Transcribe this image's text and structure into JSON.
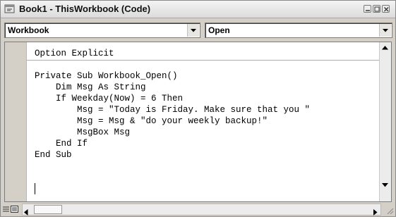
{
  "window": {
    "title": "Book1 - ThisWorkbook (Code)"
  },
  "object_dropdown": {
    "value": "Workbook"
  },
  "procedure_dropdown": {
    "value": "Open"
  },
  "code": {
    "lines": [
      "Option Explicit",
      "",
      "Private Sub Workbook_Open()",
      "    Dim Msg As String",
      "    If Weekday(Now) = 6 Then",
      "        Msg = \"Today is Friday. Make sure that you \"",
      "        Msg = Msg & \"do your weekly backup!\"",
      "        MsgBox Msg",
      "    End If",
      "End Sub"
    ]
  },
  "icons": {
    "app": "vba-code-window-icon",
    "minimize": "minimize-icon",
    "maximize": "maximize-icon",
    "close": "close-icon",
    "dropdown": "chevron-down-icon",
    "scroll_up": "scroll-up-arrow-icon",
    "scroll_down": "scroll-down-arrow-icon",
    "scroll_left": "scroll-left-arrow-icon",
    "scroll_right": "scroll-right-arrow-icon",
    "procedure_view": "procedure-view-icon",
    "full_module_view": "full-module-view-icon",
    "resize_grip": "resize-grip-icon"
  }
}
